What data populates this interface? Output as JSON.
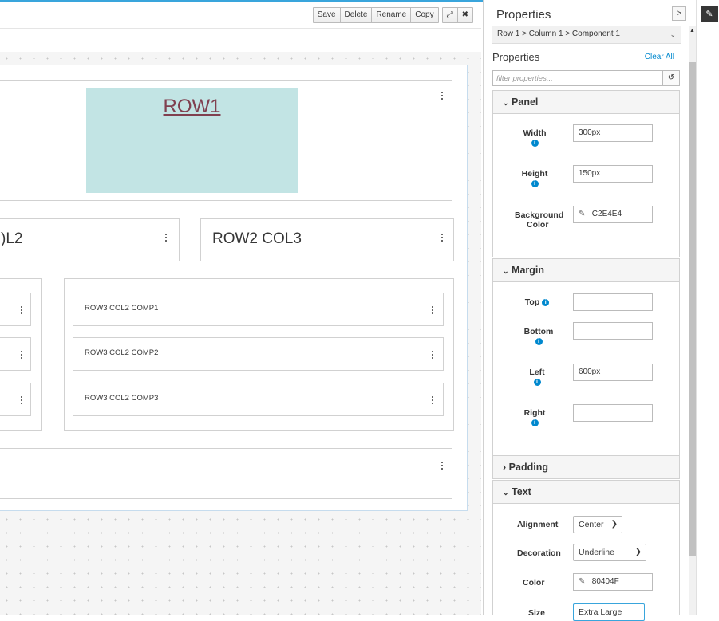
{
  "toolbar": {
    "save": "Save",
    "delete": "Delete",
    "rename": "Rename",
    "copy": "Copy",
    "expand_icon": "⤢",
    "close_icon": "✖"
  },
  "layout": {
    "row1_text": "ROW1",
    "row2_col2_text": ")L2",
    "row2_col3_text": "ROW2 COL3",
    "row3_col2_comp1": "ROW3 COL2 COMP1",
    "row3_col2_comp2": "ROW3 COL2 COMP2",
    "row3_col2_comp3": "ROW3 COL2 COMP3"
  },
  "sidebar": {
    "title": "Properties",
    "toggle_icon": ">",
    "breadcrumb": "Row 1 > Column 1 > Component 1",
    "properties_label": "Properties",
    "clear_all": "Clear All",
    "filter_placeholder": "filter properties...",
    "sections": {
      "panel": "Panel",
      "margin": "Margin",
      "padding": "Padding",
      "text": "Text"
    },
    "panel": {
      "width_label": "Width",
      "width_value": "300px",
      "height_label": "Height",
      "height_value": "150px",
      "bg_label_1": "Background",
      "bg_label_2": "Color",
      "bg_value": "C2E4E4"
    },
    "margin": {
      "top_label": "Top",
      "top_value": "",
      "bottom_label": "Bottom",
      "bottom_value": "",
      "left_label": "Left",
      "left_value": "600px",
      "right_label": "Right",
      "right_value": ""
    },
    "text": {
      "alignment_label": "Alignment",
      "alignment_value": "Center",
      "decoration_label": "Decoration",
      "decoration_value": "Underline",
      "color_label": "Color",
      "color_value": "80404F",
      "size_label": "Size",
      "size_value": "Extra Large"
    }
  },
  "colors": {
    "panel_bg": "#c2e4e4",
    "text_color": "#80404f",
    "accent": "#39a5dc",
    "link": "#0088ce"
  }
}
